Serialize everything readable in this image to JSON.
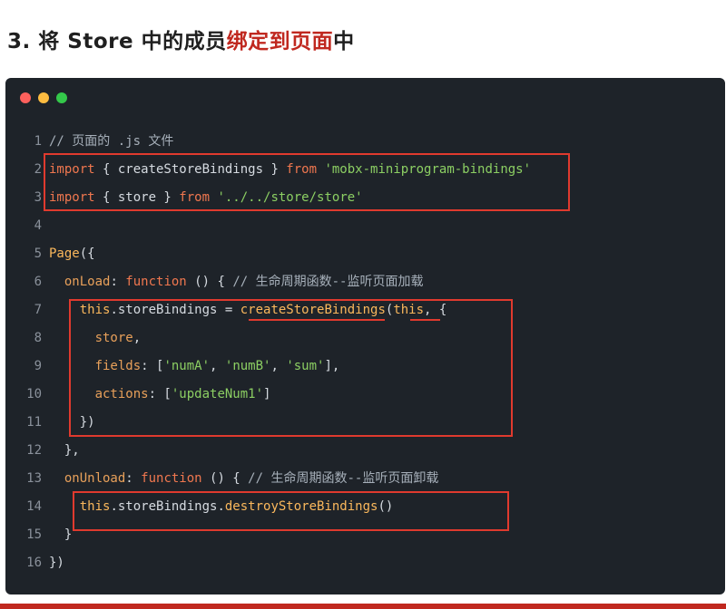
{
  "heading": {
    "prefix": "3. 将 Store 中的成员",
    "highlight": "绑定到页面",
    "suffix": "中"
  },
  "code_lines": [
    {
      "num": "1",
      "parts": [
        {
          "t": "// 页面的 .js 文件",
          "c": "c-cm"
        }
      ]
    },
    {
      "num": "2",
      "parts": [
        {
          "t": "import",
          "c": "c-kw"
        },
        {
          "t": " { createStoreBindings } ",
          "c": "c-p"
        },
        {
          "t": "from",
          "c": "c-kw"
        },
        {
          "t": " ",
          "c": "c-p"
        },
        {
          "t": "'mobx-miniprogram-bindings'",
          "c": "c-str"
        }
      ]
    },
    {
      "num": "3",
      "parts": [
        {
          "t": "import",
          "c": "c-kw"
        },
        {
          "t": " { store } ",
          "c": "c-p"
        },
        {
          "t": "from",
          "c": "c-kw"
        },
        {
          "t": " ",
          "c": "c-p"
        },
        {
          "t": "'../../store/store'",
          "c": "c-str"
        }
      ]
    },
    {
      "num": "4",
      "parts": []
    },
    {
      "num": "5",
      "parts": [
        {
          "t": "Page",
          "c": "c-fn"
        },
        {
          "t": "({",
          "c": "c-p"
        }
      ]
    },
    {
      "num": "6",
      "parts": [
        {
          "t": "  onLoad",
          "c": "c-prop"
        },
        {
          "t": ": ",
          "c": "c-p"
        },
        {
          "t": "function",
          "c": "c-kw"
        },
        {
          "t": " () { ",
          "c": "c-p"
        },
        {
          "t": "// 生命周期函数--监听页面加载",
          "c": "c-cm"
        }
      ]
    },
    {
      "num": "7",
      "parts": [
        {
          "t": "    this",
          "c": "c-this"
        },
        {
          "t": ".storeBindings = ",
          "c": "c-p"
        },
        {
          "t": "createStoreBindings",
          "c": "c-fn"
        },
        {
          "t": "(",
          "c": "c-p"
        },
        {
          "t": "this",
          "c": "c-this"
        },
        {
          "t": ", {",
          "c": "c-p"
        }
      ]
    },
    {
      "num": "8",
      "parts": [
        {
          "t": "      store",
          "c": "c-prop"
        },
        {
          "t": ",",
          "c": "c-p"
        }
      ]
    },
    {
      "num": "9",
      "parts": [
        {
          "t": "      fields",
          "c": "c-prop"
        },
        {
          "t": ": [",
          "c": "c-p"
        },
        {
          "t": "'numA'",
          "c": "c-str"
        },
        {
          "t": ", ",
          "c": "c-p"
        },
        {
          "t": "'numB'",
          "c": "c-str"
        },
        {
          "t": ", ",
          "c": "c-p"
        },
        {
          "t": "'sum'",
          "c": "c-str"
        },
        {
          "t": "],",
          "c": "c-p"
        }
      ]
    },
    {
      "num": "10",
      "parts": [
        {
          "t": "      actions",
          "c": "c-prop"
        },
        {
          "t": ": [",
          "c": "c-p"
        },
        {
          "t": "'updateNum1'",
          "c": "c-str"
        },
        {
          "t": "]",
          "c": "c-p"
        }
      ]
    },
    {
      "num": "11",
      "parts": [
        {
          "t": "    })",
          "c": "c-p"
        }
      ]
    },
    {
      "num": "12",
      "parts": [
        {
          "t": "  },",
          "c": "c-p"
        }
      ]
    },
    {
      "num": "13",
      "parts": [
        {
          "t": "  onUnload",
          "c": "c-prop"
        },
        {
          "t": ": ",
          "c": "c-p"
        },
        {
          "t": "function",
          "c": "c-kw"
        },
        {
          "t": " () { ",
          "c": "c-p"
        },
        {
          "t": "// 生命周期函数--监听页面卸载",
          "c": "c-cm"
        }
      ]
    },
    {
      "num": "14",
      "parts": [
        {
          "t": "    this",
          "c": "c-this"
        },
        {
          "t": ".storeBindings.",
          "c": "c-p"
        },
        {
          "t": "destroyStoreBindings",
          "c": "c-fn"
        },
        {
          "t": "()",
          "c": "c-p"
        }
      ]
    },
    {
      "num": "15",
      "parts": [
        {
          "t": "  }",
          "c": "c-p"
        }
      ]
    },
    {
      "num": "16",
      "parts": [
        {
          "t": "})",
          "c": "c-p"
        }
      ]
    }
  ],
  "colors": {
    "editor_bg": "#1e2329",
    "highlight_box": "#e03a2e",
    "heading_highlight": "#c0281f"
  }
}
